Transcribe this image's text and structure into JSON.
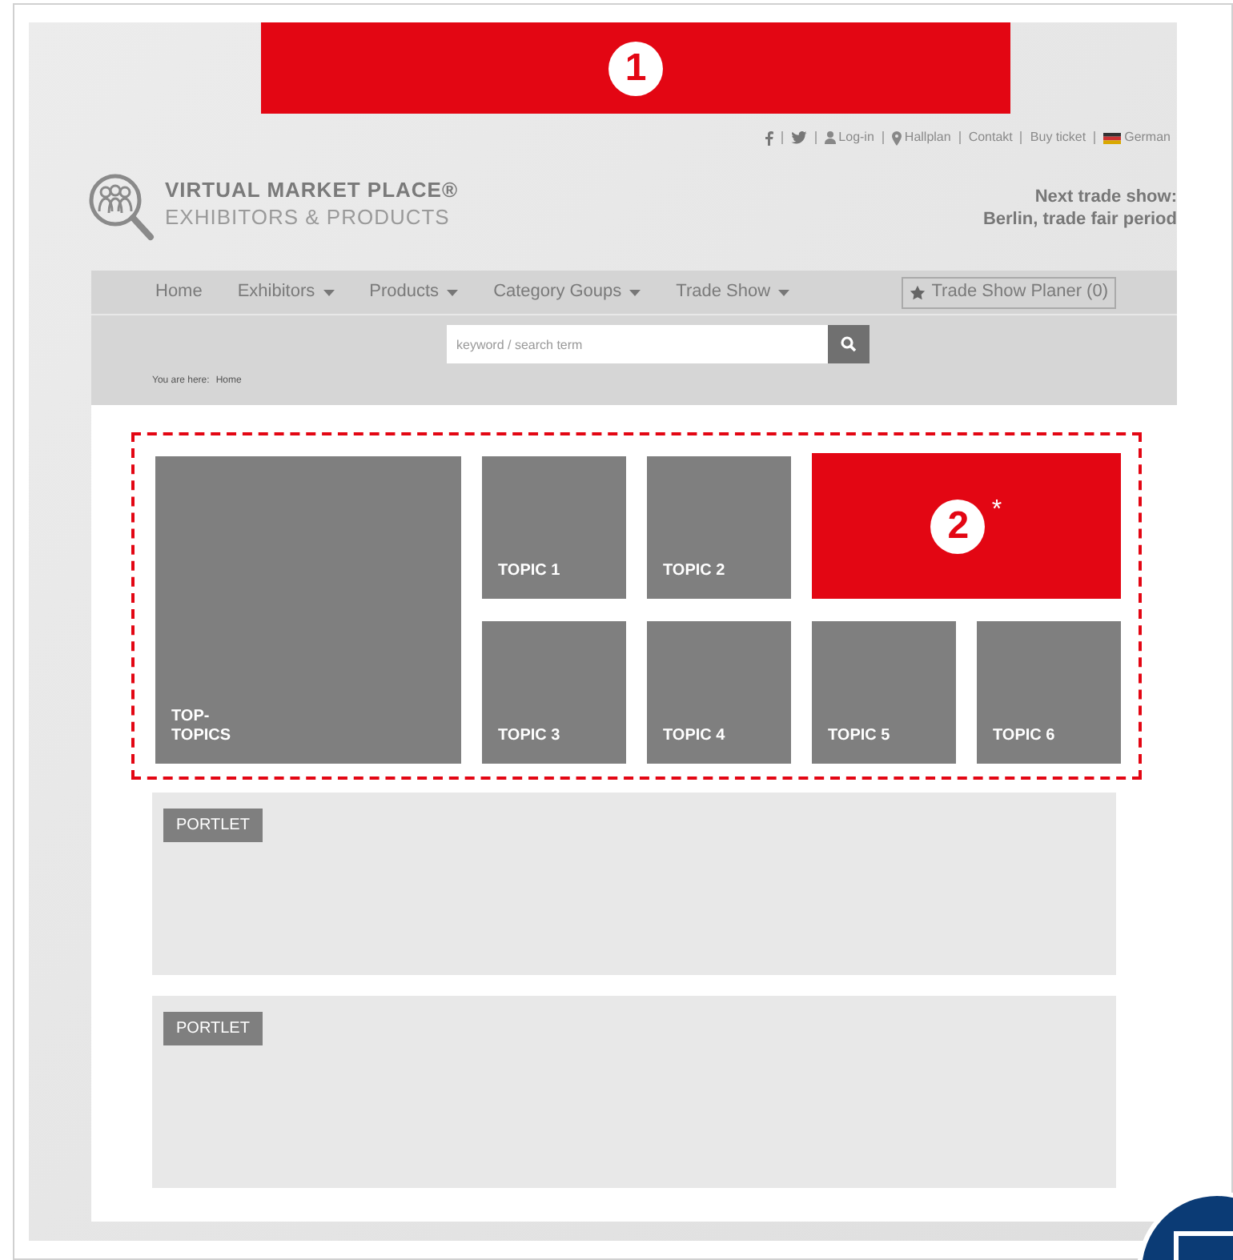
{
  "banner": {
    "marker": "1"
  },
  "top_links": [
    {
      "kind": "facebook"
    },
    {
      "kind": "twitter"
    },
    {
      "kind": "user",
      "label": "Log-in"
    },
    {
      "kind": "pin",
      "label": "Hallplan"
    },
    {
      "kind": "plain",
      "label": "Contakt"
    },
    {
      "kind": "plain",
      "label": "Buy ticket"
    },
    {
      "kind": "flag",
      "label": "German"
    }
  ],
  "logo": {
    "title": "VIRTUAL MARKET PLACE®",
    "subtitle": "EXHIBITORS & PRODUCTS"
  },
  "next_show": {
    "heading": "Next trade show:",
    "detail": "Berlin, trade fair period"
  },
  "nav": {
    "items": [
      {
        "label": "Home",
        "dropdown": false
      },
      {
        "label": "Exhibitors",
        "dropdown": true
      },
      {
        "label": "Products",
        "dropdown": true
      },
      {
        "label": "Category Goups",
        "dropdown": true
      },
      {
        "label": "Trade Show",
        "dropdown": true
      }
    ],
    "planner": "Trade Show Planer (0)"
  },
  "search": {
    "placeholder": "keyword / search term"
  },
  "breadcrumb": {
    "label": "You are here:",
    "current": "Home"
  },
  "top_topics": {
    "lines": [
      "TOP-",
      "TOPICS"
    ]
  },
  "topics": [
    "TOPIC 1",
    "TOPIC 2",
    "TOPIC 3",
    "TOPIC 4",
    "TOPIC 5",
    "TOPIC 6"
  ],
  "feature": {
    "marker": "2",
    "note": "*"
  },
  "portlets": [
    "PORTLET",
    "PORTLET"
  ]
}
